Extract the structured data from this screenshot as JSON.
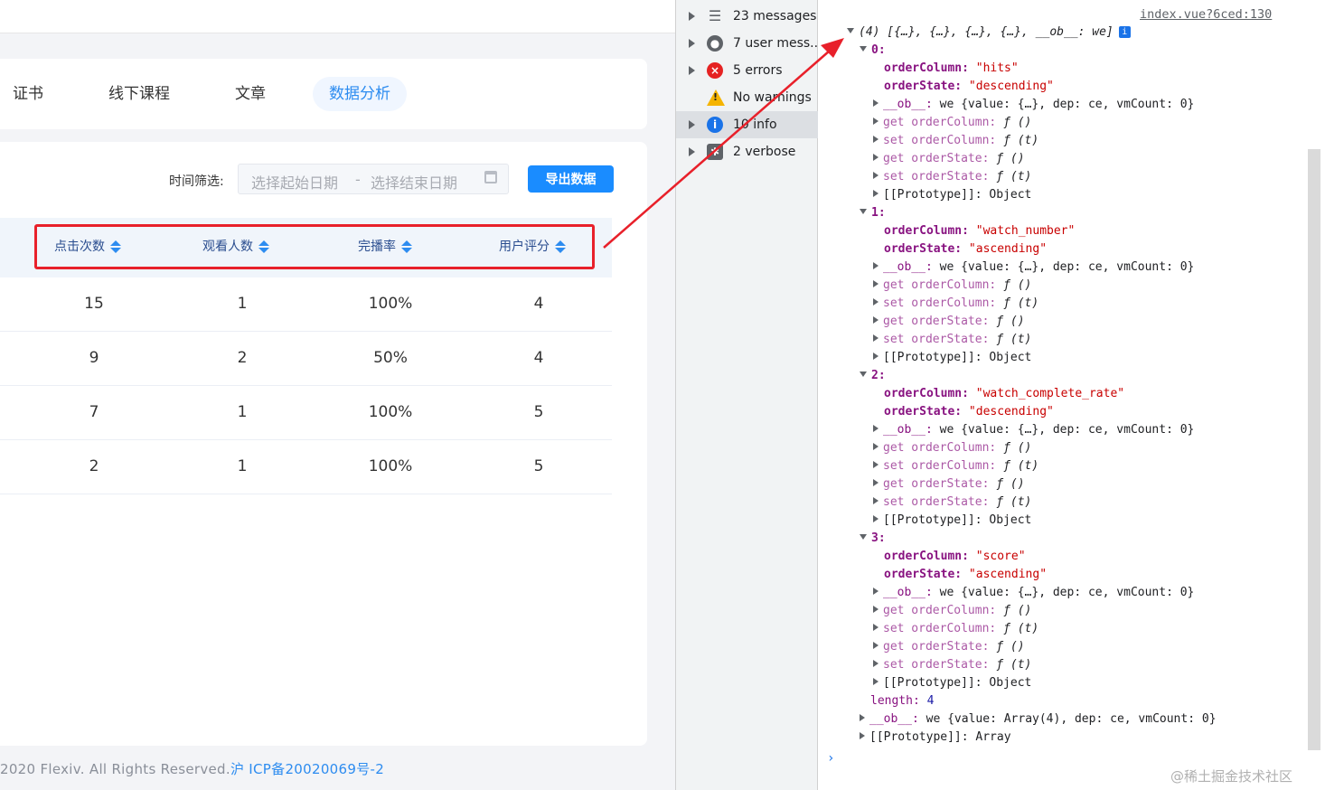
{
  "app": {
    "tabs": [
      "证书",
      "线下课程",
      "文章",
      "数据分析"
    ],
    "active_tab": "数据分析",
    "filter_label": "时间筛选:",
    "date_start_placeholder": "选择起始日期",
    "date_separator": "-",
    "date_end_placeholder": "选择结束日期",
    "export_label": "导出数据",
    "columns": [
      "点击次数",
      "观看人数",
      "完播率",
      "用户评分"
    ],
    "rows": [
      [
        "15",
        "1",
        "100%",
        "4"
      ],
      [
        "9",
        "2",
        "50%",
        "4"
      ],
      [
        "7",
        "1",
        "100%",
        "5"
      ],
      [
        "2",
        "1",
        "100%",
        "5"
      ]
    ],
    "footer_text": "2020 Flexiv. All Rights Reserved.",
    "footer_link": "沪 ICP备20020069号-2"
  },
  "sidebar": {
    "items": [
      {
        "label": "23 messages",
        "icon": "list-icon"
      },
      {
        "label": "7 user mess...",
        "icon": "user-icon"
      },
      {
        "label": "5 errors",
        "icon": "error-icon"
      },
      {
        "label": "No warnings",
        "icon": "warning-icon"
      },
      {
        "label": "10 info",
        "icon": "info-icon"
      },
      {
        "label": "2 verbose",
        "icon": "verbose-icon"
      }
    ]
  },
  "console": {
    "source_link": "index.vue?6ced:130",
    "summary": "(4) [{…}, {…}, {…}, {…}, __ob__: we]",
    "entries": [
      {
        "index": "0:",
        "orderColumn": "\"hits\"",
        "orderState": "\"descending\""
      },
      {
        "index": "1:",
        "orderColumn": "\"watch_number\"",
        "orderState": "\"ascending\""
      },
      {
        "index": "2:",
        "orderColumn": "\"watch_complete_rate\"",
        "orderState": "\"descending\""
      },
      {
        "index": "3:",
        "orderColumn": "\"score\"",
        "orderState": "\"ascending\""
      }
    ],
    "key_orderColumn": "orderColumn:",
    "key_orderState": "orderState:",
    "ob_key": "__ob__:",
    "ob_value": "we {value: {…}, dep: ce, vmCount: 0}",
    "get_col": "get orderColumn:",
    "set_col": "set orderColumn:",
    "get_state": "get orderState:",
    "set_state": "set orderState:",
    "fn_noarg": "ƒ ()",
    "fn_arg": "ƒ (t)",
    "proto_obj": "[[Prototype]]: Object",
    "length_key": "length:",
    "length_val": "4",
    "ob_array_value": "we {value: Array(4), dep: ce, vmCount: 0}",
    "proto_arr": "[[Prototype]]: Array",
    "prompt": "›",
    "watermark": "@稀土掘金技术社区"
  },
  "colors": {
    "accent": "#2d8cf0",
    "export_button": "#1a8cff",
    "highlight": "#e8202a"
  }
}
